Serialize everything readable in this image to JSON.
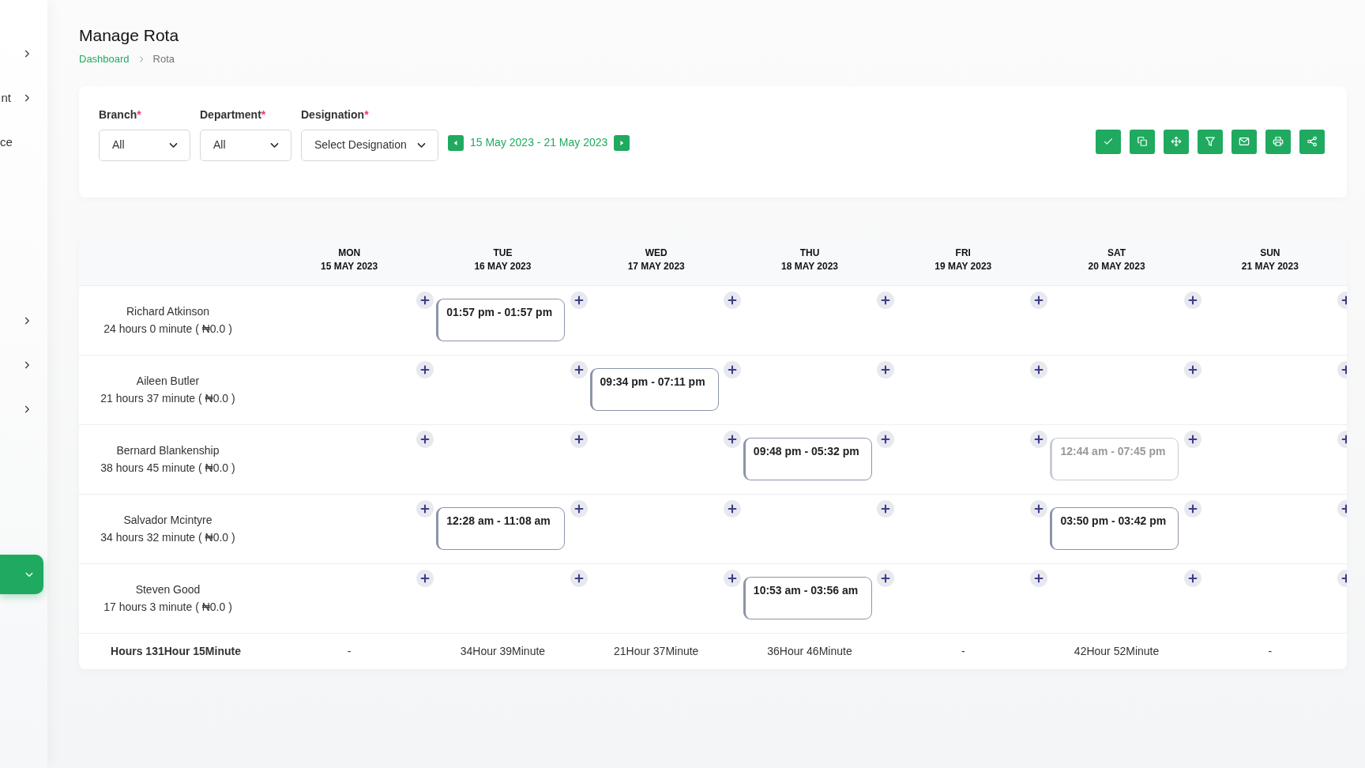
{
  "sidebar": {
    "items": [
      {
        "has_chevron": true
      },
      {
        "label": "nt",
        "has_chevron": true
      },
      {
        "label": "ce",
        "has_chevron": false
      },
      {
        "has_chevron": true
      },
      {
        "has_chevron": true
      },
      {
        "has_chevron": true
      }
    ]
  },
  "page": {
    "title": "Manage Rota",
    "breadcrumb": [
      "Dashboard",
      "Rota"
    ]
  },
  "filters": [
    {
      "label": "Branch",
      "required_mark": "*",
      "value": "All"
    },
    {
      "label": "Department",
      "required_mark": "*",
      "value": "All"
    },
    {
      "label": "Designation",
      "required_mark": "*",
      "value": "Select Designation"
    }
  ],
  "date_range": "15 May 2023 - 21 May 2023",
  "toolbar": [
    {
      "kind": "check"
    },
    {
      "kind": "copy"
    },
    {
      "kind": "move"
    },
    {
      "kind": "filter"
    },
    {
      "kind": "mail"
    },
    {
      "kind": "print"
    },
    {
      "kind": "share"
    }
  ],
  "days": [
    {
      "day": "MON",
      "date": "15 MAY 2023"
    },
    {
      "day": "TUE",
      "date": "16 MAY 2023"
    },
    {
      "day": "WED",
      "date": "17 MAY 2023"
    },
    {
      "day": "THU",
      "date": "18 MAY 2023"
    },
    {
      "day": "FRI",
      "date": "19 MAY 2023"
    },
    {
      "day": "SAT",
      "date": "20 MAY 2023"
    },
    {
      "day": "SUN",
      "date": "21 MAY 2023"
    }
  ],
  "employees": [
    {
      "name": "Richard Atkinson",
      "hours": "24 hours 0 minute ( ₦0.0 )",
      "shifts": [
        {
          "empty": true
        },
        {
          "empty": false,
          "time": "01:57 pm - 01:57 pm",
          "muted": false
        },
        {
          "empty": true
        },
        {
          "empty": true
        },
        {
          "empty": true
        },
        {
          "empty": true
        },
        {
          "empty": true
        }
      ]
    },
    {
      "name": "Aileen Butler",
      "hours": "21 hours 37 minute ( ₦0.0 )",
      "shifts": [
        {
          "empty": true
        },
        {
          "empty": true
        },
        {
          "empty": false,
          "time": "09:34 pm - 07:11 pm",
          "muted": false
        },
        {
          "empty": true
        },
        {
          "empty": true
        },
        {
          "empty": true
        },
        {
          "empty": true
        }
      ]
    },
    {
      "name": "Bernard Blankenship",
      "hours": "38 hours 45 minute ( ₦0.0 )",
      "shifts": [
        {
          "empty": true
        },
        {
          "empty": true
        },
        {
          "empty": true
        },
        {
          "empty": false,
          "time": "09:48 pm - 05:32 pm",
          "muted": false
        },
        {
          "empty": true
        },
        {
          "empty": false,
          "time": "12:44 am - 07:45 pm",
          "muted": true
        },
        {
          "empty": true
        }
      ]
    },
    {
      "name": "Salvador Mcintyre",
      "hours": "34 hours 32 minute ( ₦0.0 )",
      "shifts": [
        {
          "empty": true
        },
        {
          "empty": false,
          "time": "12:28 am - 11:08 am",
          "muted": false
        },
        {
          "empty": true
        },
        {
          "empty": true
        },
        {
          "empty": true
        },
        {
          "empty": false,
          "time": "03:50 pm - 03:42 pm",
          "muted": false
        },
        {
          "empty": true
        }
      ]
    },
    {
      "name": "Steven Good",
      "hours": "17 hours 3 minute ( ₦0.0 )",
      "shifts": [
        {
          "empty": true
        },
        {
          "empty": true
        },
        {
          "empty": true
        },
        {
          "empty": false,
          "time": "10:53 am - 03:56 am",
          "muted": false
        },
        {
          "empty": true
        },
        {
          "empty": true
        },
        {
          "empty": true
        }
      ]
    }
  ],
  "totals": {
    "label": "Hours 131Hour 15Minute",
    "days": [
      "-",
      "34Hour 39Minute",
      "21Hour 37Minute",
      "36Hour 46Minute",
      "-",
      "42Hour 52Minute",
      "-"
    ]
  }
}
